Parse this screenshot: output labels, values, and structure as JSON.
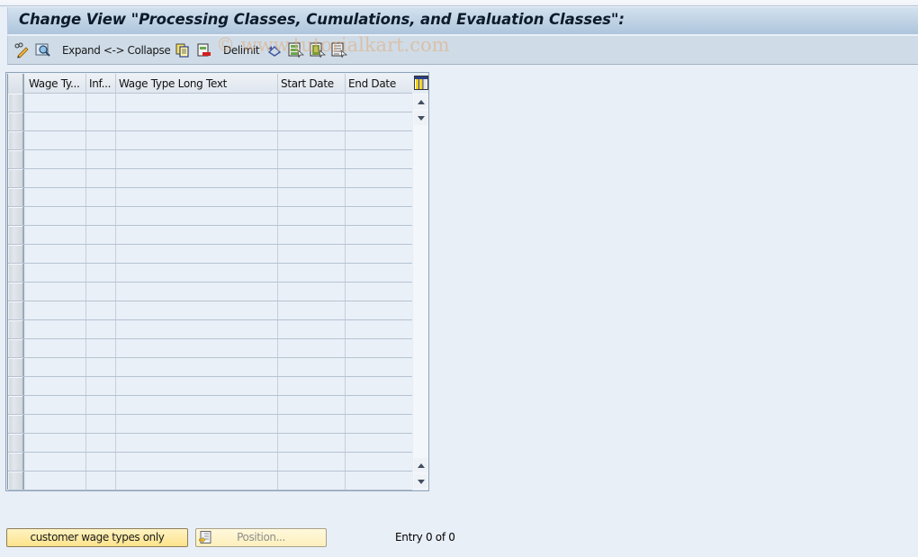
{
  "window": {
    "title": "Change View \"Processing Classes, Cumulations, and Evaluation Classes\":"
  },
  "toolbar": {
    "items": [
      {
        "type": "icon",
        "name": "change-display-icon",
        "label": "Display/Change"
      },
      {
        "type": "icon",
        "name": "find-icon",
        "label": "Find"
      },
      {
        "type": "text",
        "label": "Expand <-> Collapse"
      },
      {
        "type": "icon",
        "name": "copy-as-icon",
        "label": "Copy As"
      },
      {
        "type": "icon",
        "name": "delete-icon",
        "label": "Delete"
      },
      {
        "type": "text",
        "label": "Delimit"
      },
      {
        "type": "icon",
        "name": "undo-change-icon",
        "label": "Undo Change"
      },
      {
        "type": "icon",
        "name": "select-all-icon",
        "label": "Select All"
      },
      {
        "type": "icon",
        "name": "select-block-icon",
        "label": "Select Block"
      },
      {
        "type": "icon",
        "name": "deselect-all-icon",
        "label": "Deselect All"
      }
    ],
    "expand_collapse_label": "Expand <-> Collapse",
    "delimit_label": "Delimit"
  },
  "watermark": "© www.tutorialkart.com",
  "table": {
    "columns": [
      {
        "key": "wage_type",
        "label": "Wage Ty..."
      },
      {
        "key": "inf",
        "label": "Inf..."
      },
      {
        "key": "long_text",
        "label": "Wage Type Long Text"
      },
      {
        "key": "start_date",
        "label": "Start Date"
      },
      {
        "key": "end_date",
        "label": "End Date"
      }
    ],
    "visible_row_count": 21,
    "rows": []
  },
  "footer": {
    "customer_button_label": "customer wage types only",
    "position_button_label": "Position...",
    "entry_text": "Entry 0 of 0"
  }
}
